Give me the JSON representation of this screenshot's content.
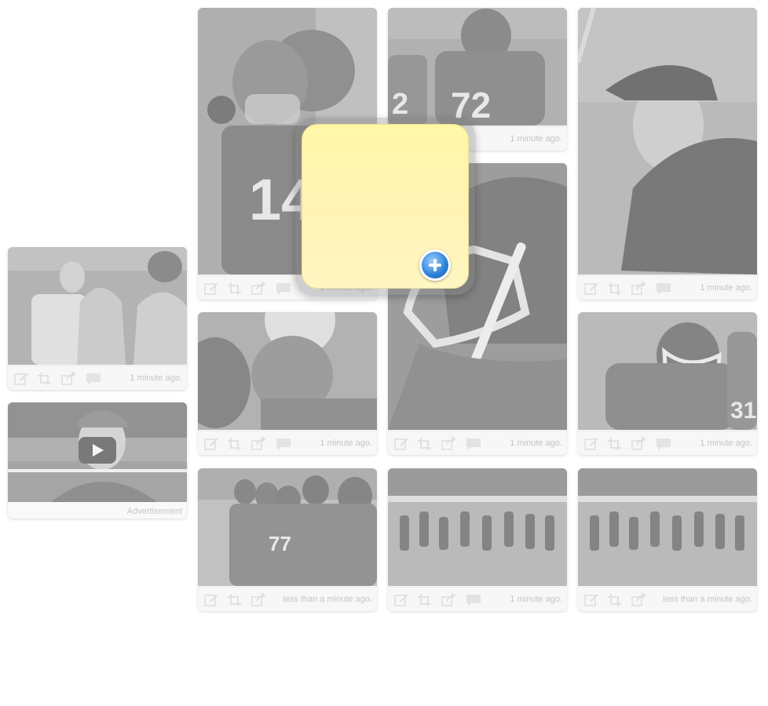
{
  "cards": [
    {
      "id": "c1",
      "stamp": "1 minute ago.",
      "alt": "Two football players in helmets, number 14"
    },
    {
      "id": "c2",
      "stamp": "1 minute ago.",
      "alt": "Football players, number 72"
    },
    {
      "id": "c3",
      "stamp": "1 minute ago.",
      "alt": "Coach in a cap watching the field"
    },
    {
      "id": "c4",
      "stamp": "1 minute ago.",
      "alt": "Fans smiling in the stands"
    },
    {
      "id": "c5",
      "stamp": "1 minute ago.",
      "alt": "Player silhouette in sunlight"
    },
    {
      "id": "c6",
      "stamp": "",
      "alt": "Close-up of football helmet"
    },
    {
      "id": "c7",
      "stamp": "1 minute ago.",
      "alt": "Player in helmet, number 31 behind"
    },
    {
      "id": "c8",
      "stamp": "less than a minute ago.",
      "alt": "Team on sideline, number 77"
    },
    {
      "id": "c9",
      "stamp": "1 minute ago.",
      "alt": "Players lined up on the field"
    },
    {
      "id": "c10",
      "stamp": "less than a minute ago.",
      "alt": "Players lined up on the field"
    }
  ],
  "video": {
    "ad_label": "Advertisement"
  },
  "colors": {
    "note": "#fff5b0",
    "add_button": "#2b7fd6"
  }
}
